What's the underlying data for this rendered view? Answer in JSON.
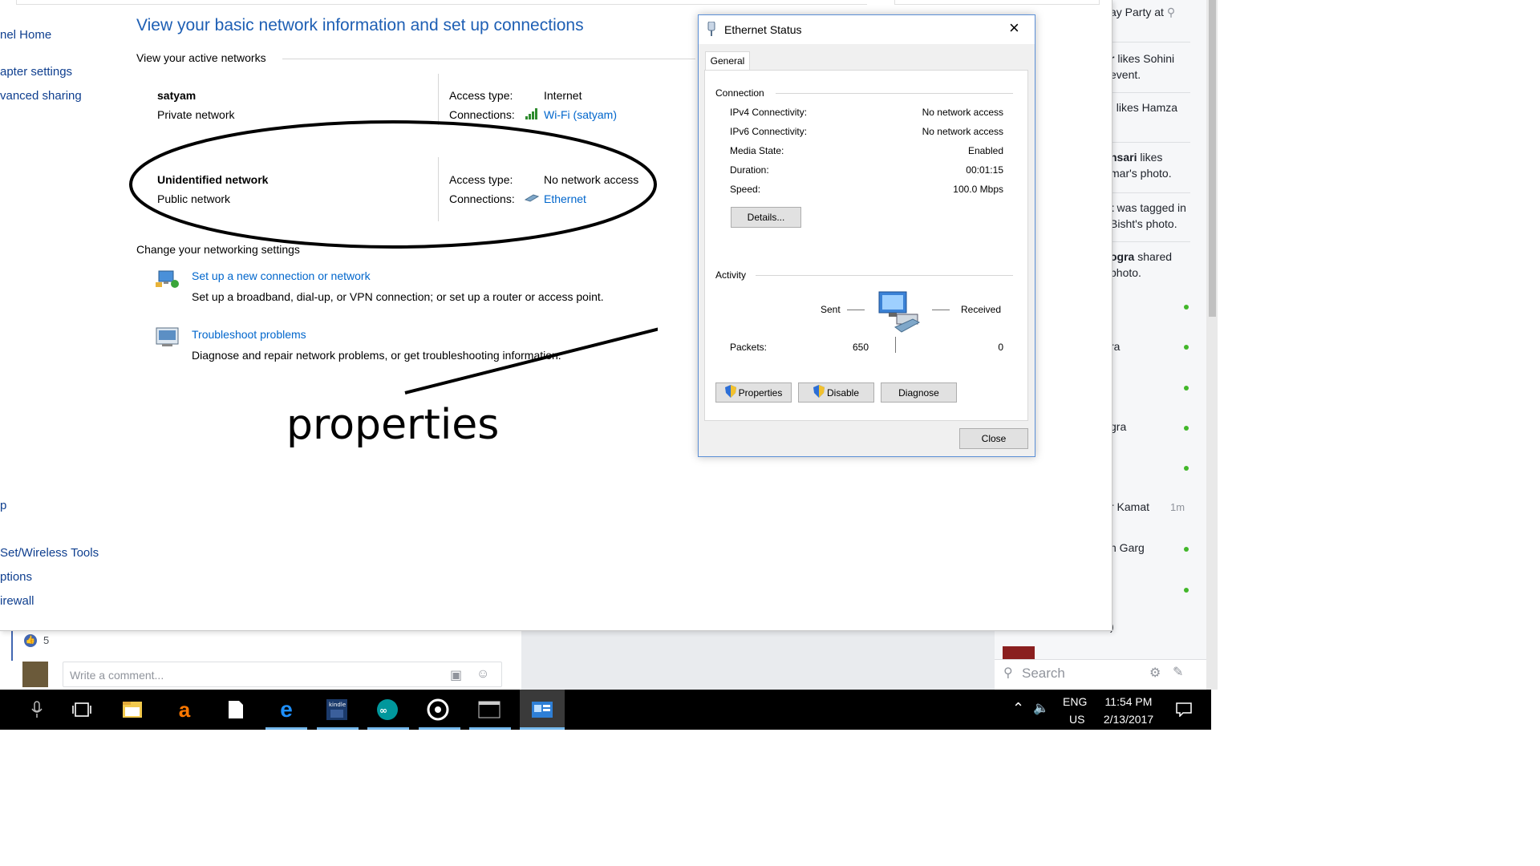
{
  "network_center": {
    "title": "View your basic network information and set up connections",
    "active_networks_label": "View your active networks",
    "sidebar": {
      "items": [
        "nel Home",
        "apter settings",
        "vanced sharing"
      ],
      "bottom_items": [
        "p",
        "Set/Wireless Tools",
        "ptions",
        "irewall"
      ]
    },
    "networks": [
      {
        "name": "satyam",
        "type": "Private network",
        "access_label": "Access type:",
        "access_value": "Internet",
        "connections_label": "Connections:",
        "connection_value": "Wi-Fi (satyam)",
        "connection_icon": "wifi-signal-icon"
      },
      {
        "name": "Unidentified network",
        "type": "Public network",
        "access_label": "Access type:",
        "access_value": "No network access",
        "connections_label": "Connections:",
        "connection_value": "Ethernet",
        "connection_icon": "ethernet-icon"
      }
    ],
    "change_settings_label": "Change your networking settings",
    "tasks": [
      {
        "title": "Set up a new connection or network",
        "description": "Set up a broadband, dial-up, or VPN connection; or set up a router or access point.",
        "icon": "new-connection-icon"
      },
      {
        "title": "Troubleshoot problems",
        "description": "Diagnose and repair network problems, or get troubleshooting information.",
        "icon": "troubleshoot-icon"
      }
    ]
  },
  "annotation": {
    "text": "properties"
  },
  "ethernet_dialog": {
    "title": "Ethernet Status",
    "tab": "General",
    "connection_label": "Connection",
    "rows": [
      {
        "label": "IPv4 Connectivity:",
        "value": "No network access"
      },
      {
        "label": "IPv6 Connectivity:",
        "value": "No network access"
      },
      {
        "label": "Media State:",
        "value": "Enabled"
      },
      {
        "label": "Duration:",
        "value": "00:01:15"
      },
      {
        "label": "Speed:",
        "value": "100.0 Mbps"
      }
    ],
    "details_button": "Details...",
    "activity_label": "Activity",
    "sent_label": "Sent",
    "received_label": "Received",
    "packets_label": "Packets:",
    "packets_sent": "650",
    "packets_received": "0",
    "properties_button": "Properties",
    "disable_button": "Disable",
    "diagnose_button": "Diagnose",
    "close_button": "Close"
  },
  "facebook": {
    "notifications": [
      {
        "before": "",
        "bold": "",
        "after": "ay Party at"
      },
      {
        "before": "",
        "bold": "r",
        "after": " likes Sohini"
      },
      {
        "before": "",
        "bold": "",
        "after": "event."
      },
      {
        "before": "",
        "bold": "i",
        "after": " likes Hamza"
      },
      {
        "before": "",
        "bold": "nsari",
        "after": " likes"
      },
      {
        "before": "",
        "bold": "",
        "after": "mar's photo."
      },
      {
        "before": "",
        "bold": "t",
        "after": " was tagged in"
      },
      {
        "before": "",
        "bold": "",
        "after": "Bisht's photo."
      },
      {
        "before": "",
        "bold": "ogra",
        "after": " shared"
      },
      {
        "before": "",
        "bold": "",
        "after": "photo."
      }
    ],
    "contacts": [
      {
        "name": "",
        "status": "online"
      },
      {
        "name": "ra",
        "status": "online"
      },
      {
        "name": "",
        "status": "online"
      },
      {
        "name": "gra",
        "status": "online"
      },
      {
        "name": "",
        "status": "online"
      },
      {
        "name": "r Kamat",
        "status": "1m"
      },
      {
        "name": "n Garg",
        "status": "online"
      },
      {
        "name": "",
        "status": "online"
      },
      {
        "name": ")",
        "status": ""
      }
    ],
    "search_placeholder": "Search",
    "like_count": "5",
    "comment_placeholder": "Write a comment..."
  },
  "taskbar": {
    "language": "ENG",
    "region": "US",
    "time": "11:54 PM",
    "date": "2/13/2017",
    "accent": "#76b9ed"
  }
}
